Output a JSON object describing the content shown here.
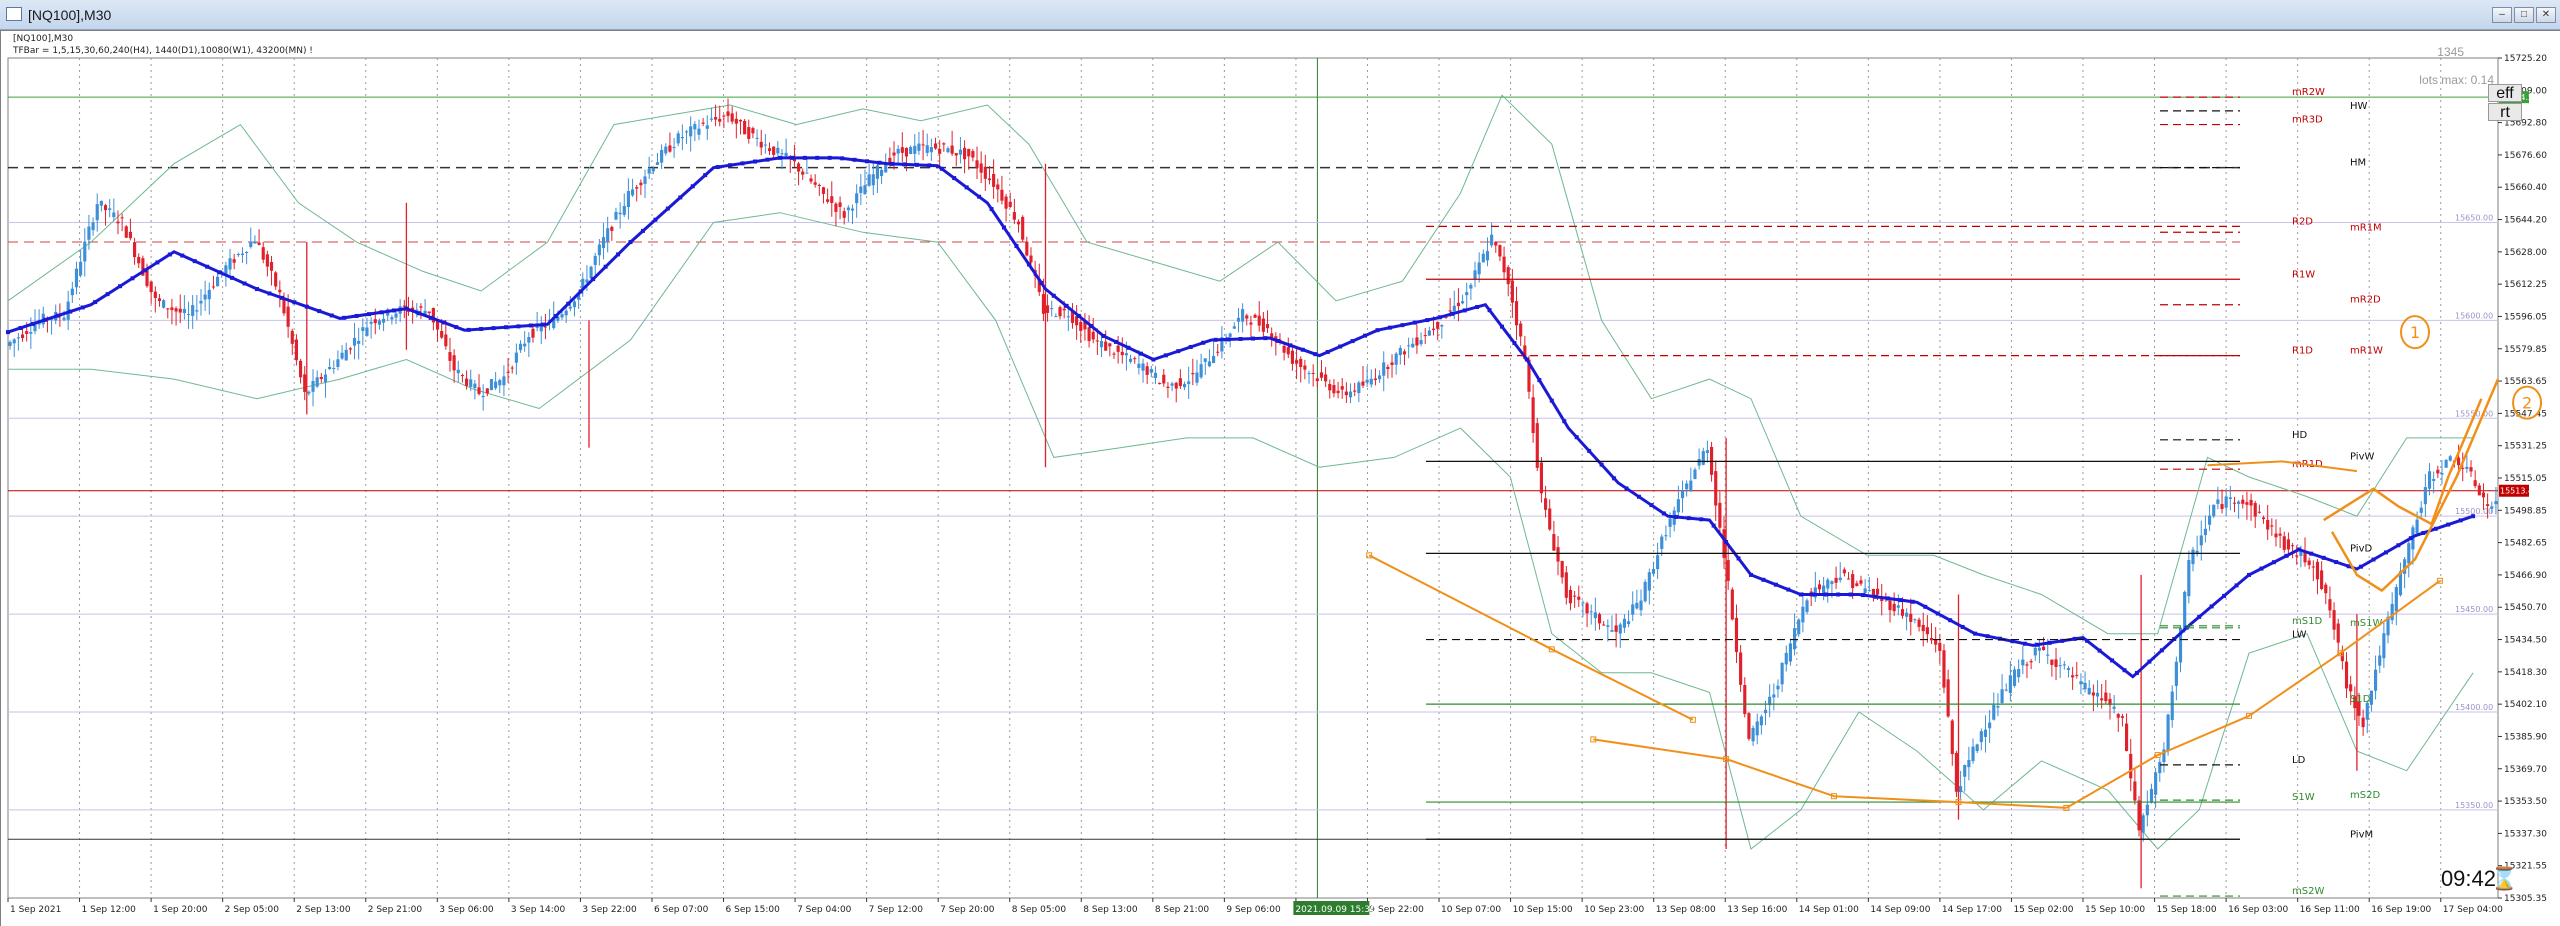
{
  "window": {
    "title": "[NQ100],M30",
    "symbol_label": "[NQ100],M30",
    "indicator_label": "TFBar = 1,5,15,30,60,240(H4), 1440(D1),10080(W1), 43200(MN) !",
    "overlay_count": "1345",
    "lots_label": "lots max: 0.14",
    "eff_label": "eff",
    "rt_label": "rt",
    "clock": "09:42",
    "hourglass_icon": "hourglass-icon"
  },
  "chart_data": {
    "type": "candlestick",
    "title": "[NQ100],M30",
    "ylim": [
      15305,
      15734
    ],
    "price_ticks": [
      "15725.20",
      "15709.00",
      "15692.80",
      "15676.60",
      "15660.40",
      "15644.20",
      "15628.00",
      "15612.25",
      "15596.05",
      "15579.85",
      "15563.65",
      "15547.45",
      "15531.25",
      "15515.05",
      "15498.85",
      "15482.65",
      "15466.90",
      "15450.70",
      "15434.50",
      "15418.30",
      "15402.10",
      "15385.90",
      "15369.70",
      "15353.50",
      "15337.30",
      "15321.55",
      "15305.35"
    ],
    "current_price": "15513.47",
    "top_price": "15714.50",
    "time_labels": [
      "1 Sep 2021",
      "1 Sep 12:00",
      "1 Sep 20:00",
      "2 Sep 05:00",
      "2 Sep 13:00",
      "2 Sep 21:00",
      "3 Sep 06:00",
      "3 Sep 14:00",
      "3 Sep 22:00",
      "6 Sep 07:00",
      "6 Sep 15:00",
      "7 Sep 04:00",
      "7 Sep 12:00",
      "7 Sep 20:00",
      "8 Sep 05:00",
      "8 Sep 13:00",
      "8 Sep 21:00",
      "9 Sep 06:00",
      "9 Sep 14:00",
      "9 Sep 22:00",
      "10 Sep 07:00",
      "10 Sep 15:00",
      "10 Sep 23:00",
      "13 Sep 08:00",
      "13 Sep 16:00",
      "14 Sep 01:00",
      "14 Sep 09:00",
      "14 Sep 17:00",
      "15 Sep 02:00",
      "15 Sep 10:00",
      "15 Sep 18:00",
      "16 Sep 03:00",
      "16 Sep 11:00",
      "16 Sep 19:00",
      "17 Sep 04:00"
    ],
    "crosshair_time": "2021.09.09 15:30",
    "price_path": [
      [
        0,
        15587
      ],
      [
        8,
        15600
      ],
      [
        14,
        15603
      ],
      [
        22,
        15660
      ],
      [
        28,
        15650
      ],
      [
        36,
        15610
      ],
      [
        44,
        15602
      ],
      [
        52,
        15625
      ],
      [
        60,
        15642
      ],
      [
        66,
        15613
      ],
      [
        72,
        15562
      ],
      [
        80,
        15580
      ],
      [
        88,
        15600
      ],
      [
        96,
        15606
      ],
      [
        102,
        15605
      ],
      [
        108,
        15575
      ],
      [
        114,
        15563
      ],
      [
        120,
        15571
      ],
      [
        126,
        15593
      ],
      [
        132,
        15600
      ],
      [
        138,
        15614
      ],
      [
        144,
        15641
      ],
      [
        150,
        15664
      ],
      [
        156,
        15680
      ],
      [
        162,
        15693
      ],
      [
        168,
        15700
      ],
      [
        174,
        15705
      ],
      [
        178,
        15697
      ],
      [
        184,
        15688
      ],
      [
        190,
        15680
      ],
      [
        196,
        15666
      ],
      [
        202,
        15654
      ],
      [
        208,
        15672
      ],
      [
        214,
        15685
      ],
      [
        220,
        15688
      ],
      [
        226,
        15688
      ],
      [
        232,
        15684
      ],
      [
        238,
        15670
      ],
      [
        244,
        15650
      ],
      [
        250,
        15605
      ],
      [
        256,
        15604
      ],
      [
        262,
        15590
      ],
      [
        268,
        15583
      ],
      [
        274,
        15576
      ],
      [
        280,
        15566
      ],
      [
        286,
        15571
      ],
      [
        292,
        15586
      ],
      [
        298,
        15603
      ],
      [
        304,
        15596
      ],
      [
        310,
        15580
      ],
      [
        316,
        15571
      ],
      [
        322,
        15562
      ],
      [
        328,
        15568
      ],
      [
        334,
        15580
      ],
      [
        340,
        15590
      ],
      [
        346,
        15600
      ],
      [
        352,
        15614
      ],
      [
        358,
        15642
      ],
      [
        362,
        15620
      ],
      [
        366,
        15580
      ],
      [
        370,
        15510
      ],
      [
        376,
        15460
      ],
      [
        382,
        15450
      ],
      [
        388,
        15440
      ],
      [
        394,
        15458
      ],
      [
        400,
        15493
      ],
      [
        406,
        15520
      ],
      [
        410,
        15536
      ],
      [
        414,
        15480
      ],
      [
        420,
        15385
      ],
      [
        426,
        15410
      ],
      [
        434,
        15460
      ],
      [
        442,
        15470
      ],
      [
        450,
        15460
      ],
      [
        458,
        15450
      ],
      [
        466,
        15432
      ],
      [
        470,
        15360
      ],
      [
        476,
        15390
      ],
      [
        484,
        15420
      ],
      [
        490,
        15432
      ],
      [
        496,
        15422
      ],
      [
        502,
        15410
      ],
      [
        506,
        15406
      ],
      [
        510,
        15394
      ],
      [
        514,
        15340
      ],
      [
        520,
        15380
      ],
      [
        526,
        15475
      ],
      [
        532,
        15505
      ],
      [
        538,
        15510
      ],
      [
        544,
        15498
      ],
      [
        550,
        15483
      ],
      [
        556,
        15476
      ],
      [
        560,
        15452
      ],
      [
        564,
        15414
      ],
      [
        568,
        15395
      ],
      [
        572,
        15430
      ],
      [
        578,
        15478
      ],
      [
        584,
        15520
      ],
      [
        590,
        15530
      ],
      [
        594,
        15520
      ],
      [
        598,
        15505
      ]
    ],
    "series": [
      {
        "name": "MA",
        "color": "#1a1ad6",
        "points": [
          [
            0,
            15594
          ],
          [
            20,
            15608
          ],
          [
            40,
            15635
          ],
          [
            60,
            15616
          ],
          [
            80,
            15601
          ],
          [
            96,
            15606
          ],
          [
            110,
            15595
          ],
          [
            130,
            15598
          ],
          [
            150,
            15640
          ],
          [
            170,
            15678
          ],
          [
            186,
            15683
          ],
          [
            200,
            15683
          ],
          [
            212,
            15680
          ],
          [
            224,
            15679
          ],
          [
            236,
            15660
          ],
          [
            250,
            15616
          ],
          [
            264,
            15592
          ],
          [
            276,
            15580
          ],
          [
            290,
            15590
          ],
          [
            304,
            15591
          ],
          [
            316,
            15582
          ],
          [
            330,
            15595
          ],
          [
            344,
            15601
          ],
          [
            356,
            15608
          ],
          [
            366,
            15580
          ],
          [
            376,
            15545
          ],
          [
            388,
            15517
          ],
          [
            400,
            15500
          ],
          [
            410,
            15498
          ],
          [
            420,
            15470
          ],
          [
            432,
            15460
          ],
          [
            446,
            15460
          ],
          [
            460,
            15456
          ],
          [
            474,
            15440
          ],
          [
            488,
            15434
          ],
          [
            500,
            15438
          ],
          [
            512,
            15418
          ],
          [
            526,
            15445
          ],
          [
            540,
            15470
          ],
          [
            552,
            15483
          ],
          [
            566,
            15473
          ],
          [
            580,
            15490
          ],
          [
            594,
            15500
          ]
        ]
      },
      {
        "name": "BB upper",
        "color": "#6fb88f",
        "points": [
          [
            0,
            15610
          ],
          [
            20,
            15640
          ],
          [
            40,
            15680
          ],
          [
            56,
            15700
          ],
          [
            70,
            15660
          ],
          [
            84,
            15640
          ],
          [
            100,
            15625
          ],
          [
            114,
            15615
          ],
          [
            130,
            15640
          ],
          [
            146,
            15700
          ],
          [
            160,
            15705
          ],
          [
            174,
            15710
          ],
          [
            190,
            15700
          ],
          [
            206,
            15708
          ],
          [
            220,
            15702
          ],
          [
            236,
            15710
          ],
          [
            246,
            15690
          ],
          [
            260,
            15640
          ],
          [
            276,
            15630
          ],
          [
            292,
            15620
          ],
          [
            306,
            15640
          ],
          [
            320,
            15610
          ],
          [
            336,
            15620
          ],
          [
            350,
            15665
          ],
          [
            360,
            15715
          ],
          [
            372,
            15690
          ],
          [
            384,
            15600
          ],
          [
            396,
            15560
          ],
          [
            410,
            15570
          ],
          [
            420,
            15560
          ],
          [
            432,
            15500
          ],
          [
            448,
            15480
          ],
          [
            464,
            15480
          ],
          [
            476,
            15470
          ],
          [
            490,
            15460
          ],
          [
            506,
            15440
          ],
          [
            518,
            15440
          ],
          [
            530,
            15530
          ],
          [
            540,
            15520
          ],
          [
            554,
            15510
          ],
          [
            566,
            15500
          ],
          [
            578,
            15540
          ],
          [
            594,
            15540
          ]
        ]
      },
      {
        "name": "BB lower",
        "color": "#6fb88f",
        "points": [
          [
            0,
            15575
          ],
          [
            20,
            15575
          ],
          [
            40,
            15570
          ],
          [
            60,
            15560
          ],
          [
            80,
            15570
          ],
          [
            96,
            15580
          ],
          [
            112,
            15565
          ],
          [
            128,
            15555
          ],
          [
            150,
            15590
          ],
          [
            170,
            15650
          ],
          [
            186,
            15655
          ],
          [
            206,
            15645
          ],
          [
            224,
            15640
          ],
          [
            238,
            15600
          ],
          [
            252,
            15530
          ],
          [
            268,
            15535
          ],
          [
            284,
            15540
          ],
          [
            300,
            15540
          ],
          [
            316,
            15525
          ],
          [
            334,
            15530
          ],
          [
            350,
            15545
          ],
          [
            362,
            15520
          ],
          [
            372,
            15440
          ],
          [
            384,
            15420
          ],
          [
            396,
            15420
          ],
          [
            410,
            15410
          ],
          [
            420,
            15330
          ],
          [
            432,
            15350
          ],
          [
            446,
            15400
          ],
          [
            460,
            15380
          ],
          [
            476,
            15350
          ],
          [
            490,
            15375
          ],
          [
            506,
            15360
          ],
          [
            518,
            15330
          ],
          [
            528,
            15350
          ],
          [
            540,
            15430
          ],
          [
            554,
            15440
          ],
          [
            566,
            15380
          ],
          [
            578,
            15370
          ],
          [
            594,
            15420
          ]
        ]
      }
    ],
    "levels": [
      {
        "label": "mR2W",
        "price": 15714,
        "color": "#c00000",
        "style": "dashed"
      },
      {
        "label": "HW",
        "price": 15707,
        "color": "#111111",
        "style": "dashed"
      },
      {
        "label": "mR3D",
        "price": 15700,
        "color": "#c00000",
        "style": "dashed"
      },
      {
        "label": "HM",
        "price": 15678,
        "color": "#111111",
        "style": "dashed"
      },
      {
        "label": "R2D",
        "price": 15648,
        "color": "#c00000",
        "style": "dashed"
      },
      {
        "label": "mR1M",
        "price": 15645,
        "color": "#c00000",
        "style": "dashed"
      },
      {
        "label": "R1W",
        "price": 15621,
        "color": "#c00000",
        "style": "solid"
      },
      {
        "label": "mR2D",
        "price": 15608,
        "color": "#c00000",
        "style": "dashed"
      },
      {
        "label": "R1D",
        "price": 15582,
        "color": "#c00000",
        "style": "dashed"
      },
      {
        "label": "mR1W",
        "price": 15582,
        "color": "#c00000",
        "style": "dashed"
      },
      {
        "label": "HD",
        "price": 15539,
        "color": "#111111",
        "style": "dashed"
      },
      {
        "label": "PivW",
        "price": 15528,
        "color": "#111111",
        "style": "solid"
      },
      {
        "label": "mR1D",
        "price": 15524,
        "color": "#c00000",
        "style": "dashed"
      },
      {
        "label": "PivD",
        "price": 15481,
        "color": "#111111",
        "style": "solid"
      },
      {
        "label": "mS1D",
        "price": 15444,
        "color": "#2e8b2e",
        "style": "dashed"
      },
      {
        "label": "mS1W",
        "price": 15443,
        "color": "#2e8b2e",
        "style": "dashed"
      },
      {
        "label": "LW",
        "price": 15437,
        "color": "#111111",
        "style": "dashed"
      },
      {
        "label": "S1D",
        "price": 15404,
        "color": "#2e8b2e",
        "style": "solid"
      },
      {
        "label": "LD",
        "price": 15373,
        "color": "#111111",
        "style": "dashed"
      },
      {
        "label": "mS2D",
        "price": 15355,
        "color": "#2e8b2e",
        "style": "dashed"
      },
      {
        "label": "S1W",
        "price": 15354,
        "color": "#2e8b2e",
        "style": "solid"
      },
      {
        "label": "PivM",
        "price": 15335,
        "color": "#111111",
        "style": "solid"
      },
      {
        "label": "mS2W",
        "price": 15306,
        "color": "#2e8b2e",
        "style": "dashed"
      }
    ],
    "lavender_labels": [
      {
        "label": "15650.00",
        "price": 15650
      },
      {
        "label": "15600.00",
        "price": 15600
      },
      {
        "label": "15550.00",
        "price": 15550
      },
      {
        "label": "15500.00",
        "price": 15500
      },
      {
        "label": "15450.00",
        "price": 15450
      },
      {
        "label": "15400.00",
        "price": 15400
      },
      {
        "label": "15350.00",
        "price": 15350
      }
    ],
    "annotations": [
      "1",
      "2"
    ],
    "colors": {
      "up": "#3d8fd8",
      "down": "#e0202a",
      "ma": "#1a1ad6",
      "bands": "#6fb88f",
      "trend": "#f0901a",
      "level_red": "#c00000",
      "level_green": "#2e8b2e",
      "current": "#c00000"
    }
  }
}
